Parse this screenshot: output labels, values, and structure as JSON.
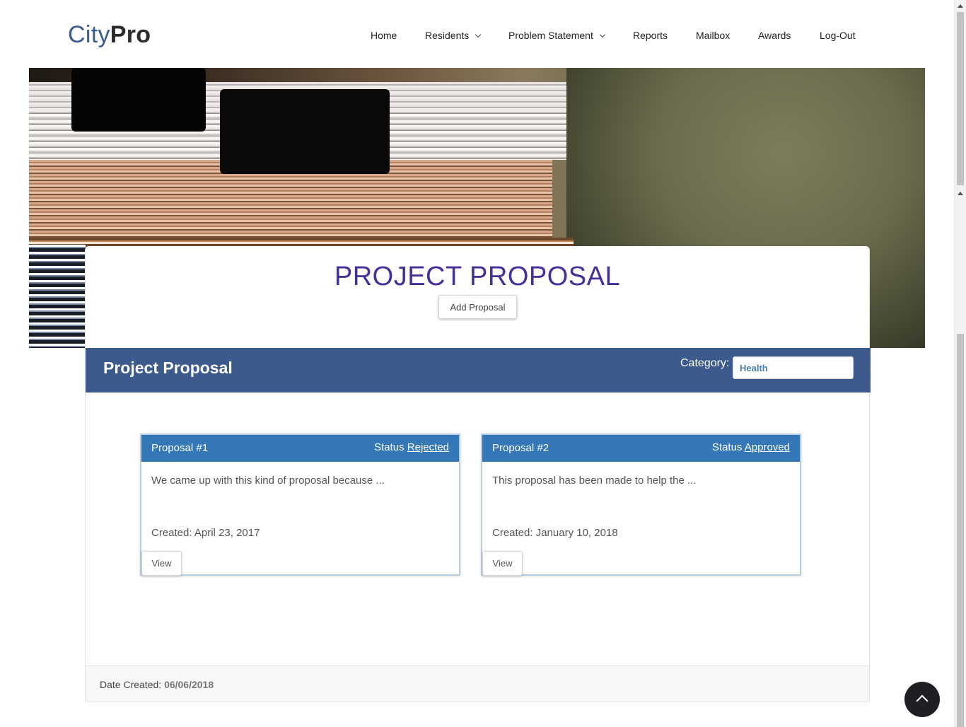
{
  "brand": {
    "part1": "City",
    "part2": "Pro"
  },
  "nav": {
    "home": "Home",
    "residents": "Residents",
    "problem_statement": "Problem Statement",
    "reports": "Reports",
    "mailbox": "Mailbox",
    "awards": "Awards",
    "logout": "Log-Out"
  },
  "page": {
    "title": "PROJECT PROPOSAL",
    "add_button": "Add Proposal"
  },
  "panel": {
    "title": "Project Proposal",
    "category_label": "Category:",
    "category_value": "Health"
  },
  "proposals": [
    {
      "name": "Proposal #1",
      "status_label": "Status",
      "status": "Rejected",
      "description": "We came up with this kind of proposal because ...",
      "created": "Created: April 23, 2017",
      "view_label": "View"
    },
    {
      "name": "Proposal #2",
      "status_label": "Status",
      "status": "Approved",
      "description": "This proposal has been made to help the ...",
      "created": "Created: January 10, 2018",
      "view_label": "View"
    }
  ],
  "footer": {
    "date_label": "Date Created:",
    "date_value": "06/06/2018"
  }
}
